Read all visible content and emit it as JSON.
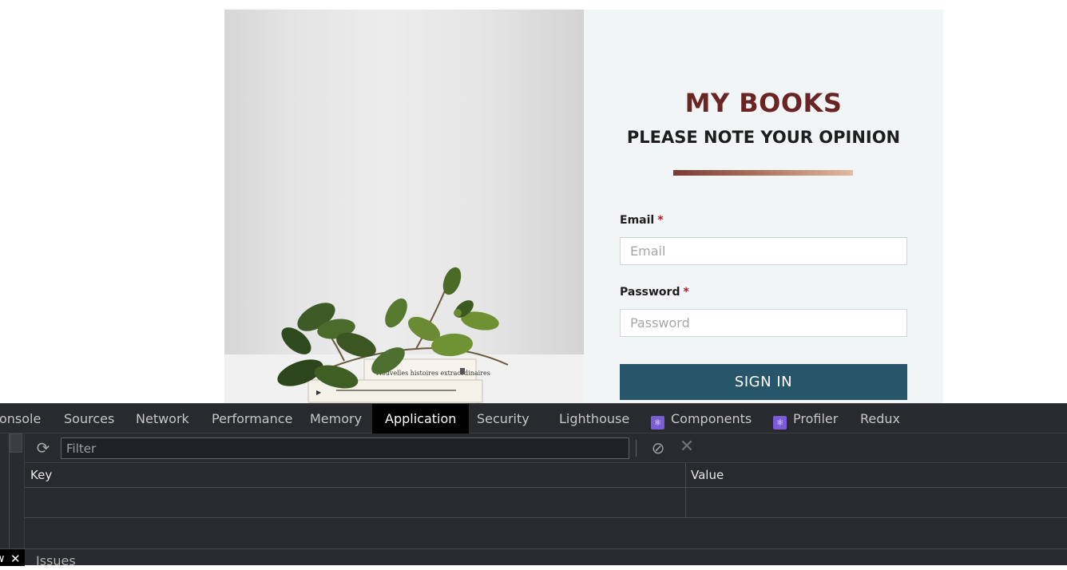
{
  "page": {
    "title": "MY BOOKS",
    "subtitle": "PLEASE NOTE YOUR OPINION",
    "email_label": "Email",
    "email_placeholder": "Email",
    "password_label": "Password",
    "password_placeholder": "Password",
    "required_mark": "*",
    "signin_label": "SIGN IN",
    "book_spine_1": "Nouvelles histoires extraordinaires",
    "colors": {
      "title": "#6b2424",
      "button": "#27566b",
      "panel": "#f2f5f6"
    }
  },
  "devtools": {
    "tabs": [
      {
        "label": "onsole",
        "active": false
      },
      {
        "label": "Sources",
        "active": false
      },
      {
        "label": "Network",
        "active": false
      },
      {
        "label": "Performance",
        "active": false
      },
      {
        "label": "Memory",
        "active": false
      },
      {
        "label": "Application",
        "active": true
      },
      {
        "label": "Security",
        "active": false
      },
      {
        "label": "Lighthouse",
        "active": false
      },
      {
        "label": "Components",
        "active": false,
        "icon": "react-icon"
      },
      {
        "label": "Profiler",
        "active": false,
        "icon": "react-icon"
      },
      {
        "label": "Redux",
        "active": false
      }
    ],
    "filter_placeholder": "Filter",
    "columns": {
      "key": "Key",
      "value": "Value"
    },
    "drawer": {
      "active_tab": "w",
      "close": "✕",
      "issues": "Issues"
    }
  }
}
